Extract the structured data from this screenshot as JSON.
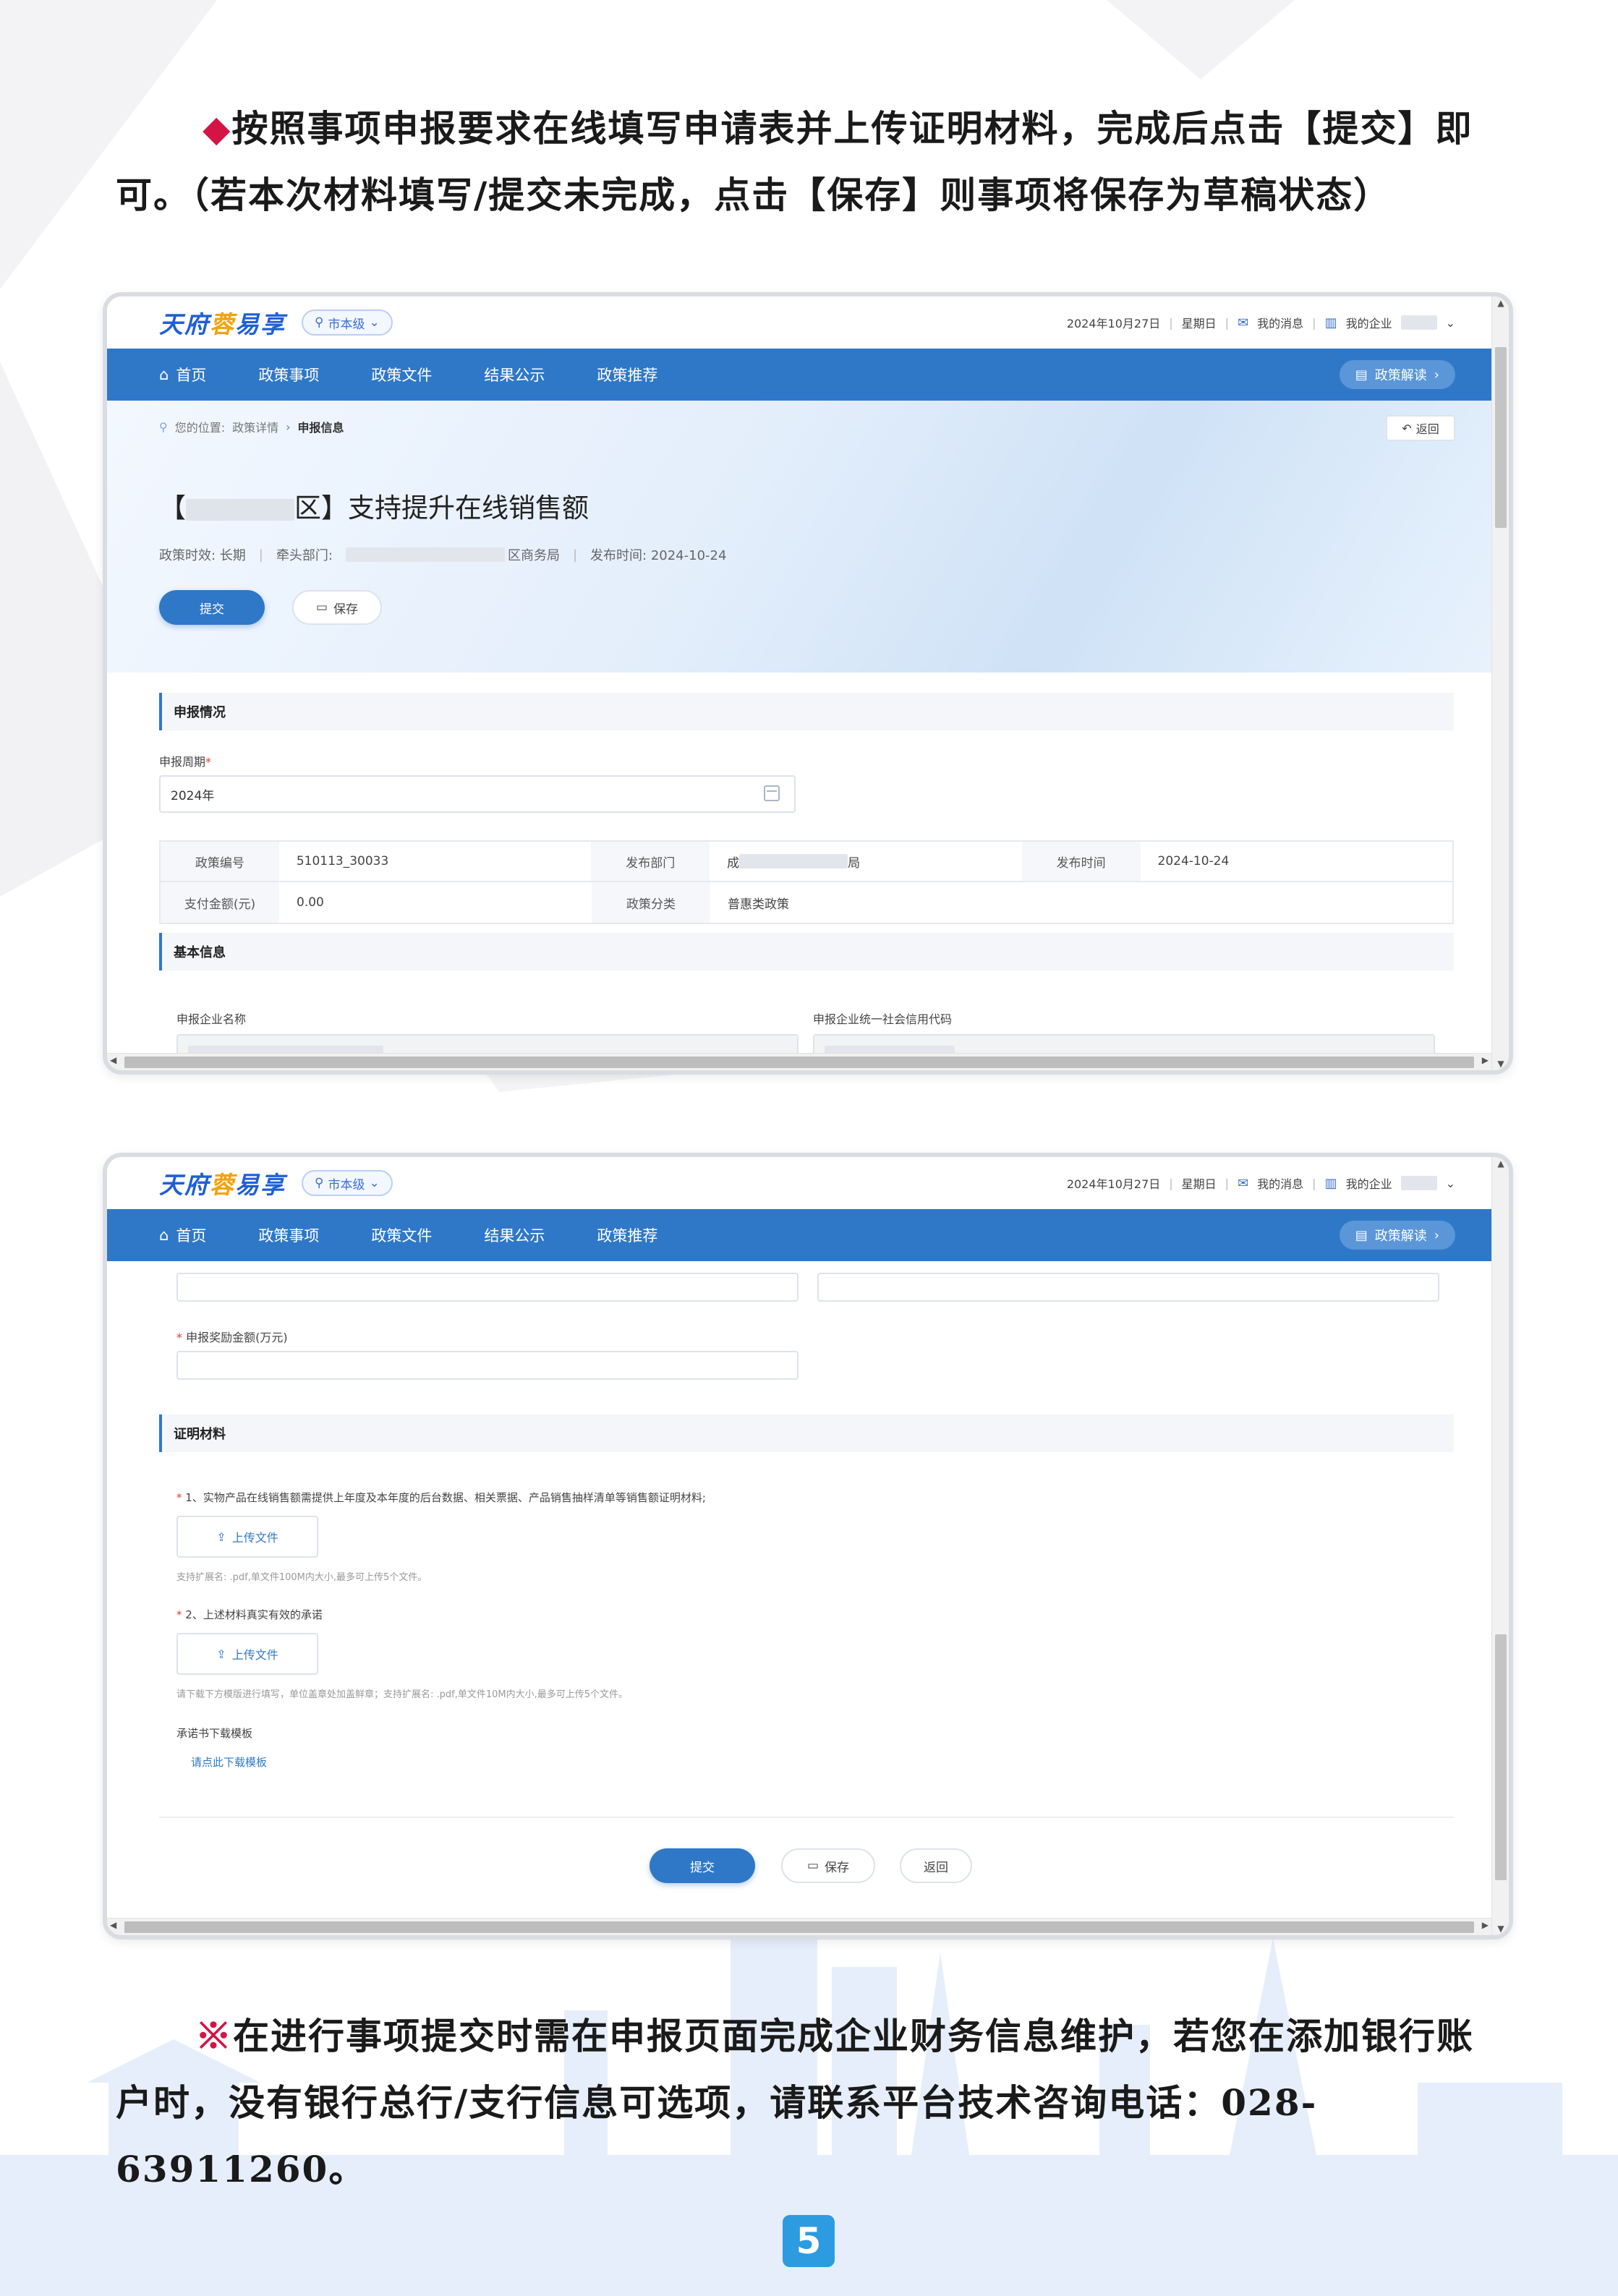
{
  "doc": {
    "para1": "按照事项申报要求在线填写申请表并上传证明材料，完成后点击【提交】即可。（若本次材料填写/提交未完成，点击【保存】则事项将保存为草稿状态）",
    "para2_mark": "※",
    "para2": "在进行事项提交时需在申报页面完成企业财务信息维护，若您在添加银行账户时，没有银行总行/支行信息可选项，请联系平台技术咨询电话：028-63911260。",
    "page_number": "5",
    "colors": {
      "accent": "#2f78c8",
      "bullet": "#d41445",
      "page_badge": "#2c9be0"
    }
  },
  "app": {
    "logo_part1": "天府",
    "logo_part2": "蓉",
    "logo_part3": "易享",
    "region": "市本级",
    "date": "2024年10月27日",
    "weekday": "星期日",
    "messages": "我的消息",
    "company": "我的企业",
    "nav": [
      "首页",
      "政策事项",
      "政策文件",
      "结果公示",
      "政策推荐"
    ],
    "policy_button": "政策解读"
  },
  "shot1": {
    "breadcrumb_prefix": "您的位置:",
    "breadcrumb_1": "政策详情",
    "breadcrumb_2": "申报信息",
    "back": "返回",
    "title_left": "【",
    "title_right": "区】支持提升在线销售额",
    "meta_effect": "政策时效: 长期",
    "meta_dept_label": "牵头部门:",
    "meta_dept_suffix": "区商务局",
    "meta_publish": "发布时间: 2024-10-24",
    "submit": "提交",
    "save": "保存",
    "section_apply": "申报情况",
    "period_label": "申报周期",
    "period_value": "2024年",
    "table": {
      "policy_no_label": "政策编号",
      "policy_no": "510113_30033",
      "dept_label": "发布部门",
      "dept_left": "成",
      "dept_right": "局",
      "time_label": "发布时间",
      "time": "2024-10-24",
      "amount_label": "支付金额(元)",
      "amount": "0.00",
      "category_label": "政策分类",
      "category": "普惠类政策"
    },
    "section_basic": "基本信息",
    "company_name_label": "申报企业名称",
    "credit_code_label": "申报企业统一社会信用代码"
  },
  "shot2": {
    "reward_label": "申报奖励金额(万元)",
    "section_proof": "证明材料",
    "req1": "1、实物产品在线销售额需提供上年度及本年度的后台数据、相关票据、产品销售抽样清单等销售额证明材料;",
    "upload": "上传文件",
    "hint1": "支持扩展名: .pdf,单文件100M内大小,最多可上传5个文件。",
    "req2": "2、上述材料真实有效的承诺",
    "hint2": "请下载下方模版进行填写，单位盖章处加盖鲜章；支持扩展名: .pdf,单文件10M内大小,最多可上传5个文件。",
    "template_label": "承诺书下载模板",
    "template_link": "请点此下载模板",
    "submit": "提交",
    "save": "保存",
    "back": "返回"
  }
}
